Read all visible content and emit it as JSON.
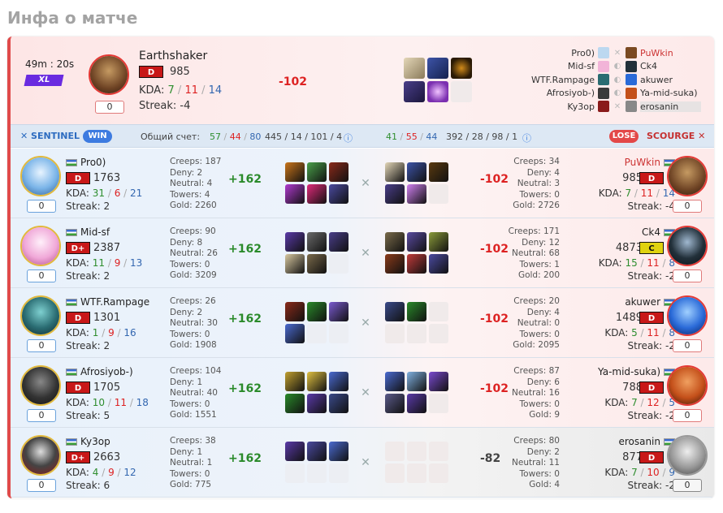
{
  "page_title": "Инфа о матче",
  "colors": {
    "radiant": "#2d6cc0",
    "dire": "#c53030",
    "win": "#3d7be0",
    "lose": "#e34848",
    "rank": "#c81818"
  },
  "featured": {
    "duration": "49m : 20s",
    "badge": "XL",
    "hero": "Earthshaker",
    "rank": "D",
    "mmr": "985",
    "kda_label": "KDA:",
    "k": "7",
    "d": "11",
    "a": "14",
    "streak": "Streak: -4",
    "score": "0",
    "diff": "-102",
    "dire_list": [
      {
        "left": "Pro0)",
        "right": "PuWkin",
        "right_style": "red"
      },
      {
        "left": "Mid-sf",
        "right": "Ck4",
        "right_style": ""
      },
      {
        "left": "WTF.Rampage",
        "right": "akuwer",
        "right_style": ""
      },
      {
        "left": "Afrosiyob-)",
        "right": "Ya-mid-suka)",
        "right_style": ""
      },
      {
        "left": "Ky3op",
        "right": "erosanin",
        "right_style": "hl"
      }
    ]
  },
  "bar": {
    "sentinel": "SENTINEL",
    "win": "WIN",
    "score_label": "Общий счет:",
    "s_k": "57",
    "s_d": "44",
    "s_a": "80",
    "s_extra": "445 / 14 / 101 / 4",
    "d_k": "41",
    "d_d": "55",
    "d_a": "44",
    "d_extra": "392 / 28 / 98 / 1",
    "lose": "LOSE",
    "scourge": "SCOURGE"
  },
  "rows": [
    {
      "name": "Pro0)",
      "rank": "D",
      "mmr": "1763",
      "k": "31",
      "d": "6",
      "a": "21",
      "streak": "Streak: 2",
      "score": "0",
      "creeps": "Creeps: 187",
      "deny": "Deny: 2",
      "neutral": "Neutral: 4",
      "towers": "Towers: 4",
      "gold": "Gold: 2260",
      "diff": "+162",
      "r_creeps": "Creeps: 34",
      "r_deny": "Deny: 4",
      "r_neutral": "Neutral: 3",
      "r_towers": "Towers: 0",
      "r_gold": "Gold: 2726",
      "r_diff": "-102",
      "r_name": "PuWkin",
      "r_rank": "D",
      "r_mmr": "985",
      "r_k": "7",
      "r_d": "11",
      "r_a": "14",
      "r_streak": "Streak: -4",
      "r_score": "0"
    },
    {
      "name": "Mid-sf",
      "rank": "D+",
      "mmr": "2387",
      "k": "11",
      "d": "9",
      "a": "13",
      "streak": "Streak: 2",
      "score": "0",
      "creeps": "Creeps: 90",
      "deny": "Deny: 8",
      "neutral": "Neutral: 26",
      "towers": "Towers: 0",
      "gold": "Gold: 3209",
      "diff": "+162",
      "r_creeps": "Creeps: 171",
      "r_deny": "Deny: 12",
      "r_neutral": "Neutral: 68",
      "r_towers": "Towers: 1",
      "r_gold": "Gold: 200",
      "r_diff": "-102",
      "r_name": "Ck4",
      "r_rank": "C",
      "r_mmr": "4873",
      "r_k": "15",
      "r_d": "11",
      "r_a": "8",
      "r_streak": "Streak: -2",
      "r_score": "0"
    },
    {
      "name": "WTF.Rampage",
      "rank": "D",
      "mmr": "1301",
      "k": "1",
      "d": "9",
      "a": "16",
      "streak": "Streak: 2",
      "score": "0",
      "creeps": "Creeps: 26",
      "deny": "Deny: 2",
      "neutral": "Neutral: 30",
      "towers": "Towers: 0",
      "gold": "Gold: 1908",
      "diff": "+162",
      "r_creeps": "Creeps: 20",
      "r_deny": "Deny: 4",
      "r_neutral": "Neutral: 0",
      "r_towers": "Towers: 0",
      "r_gold": "Gold: 2095",
      "r_diff": "-102",
      "r_name": "akuwer",
      "r_rank": "D",
      "r_mmr": "1489",
      "r_k": "5",
      "r_d": "11",
      "r_a": "8",
      "r_streak": "Streak: -2",
      "r_score": "0"
    },
    {
      "name": "Afrosiyob-)",
      "rank": "D",
      "mmr": "1705",
      "k": "10",
      "d": "11",
      "a": "18",
      "streak": "Streak: 5",
      "score": "0",
      "creeps": "Creeps: 104",
      "deny": "Deny: 1",
      "neutral": "Neutral: 40",
      "towers": "Towers: 0",
      "gold": "Gold: 1551",
      "diff": "+162",
      "r_creeps": "Creeps: 87",
      "r_deny": "Deny: 6",
      "r_neutral": "Neutral: 16",
      "r_towers": "Towers: 0",
      "r_gold": "Gold: 9",
      "r_diff": "-102",
      "r_name": "Ya-mid-suka)",
      "r_rank": "D",
      "r_mmr": "788",
      "r_k": "7",
      "r_d": "12",
      "r_a": "5",
      "r_streak": "Streak: -2",
      "r_score": "0"
    },
    {
      "name": "Ky3op",
      "rank": "D+",
      "mmr": "2663",
      "k": "4",
      "d": "9",
      "a": "12",
      "streak": "Streak: 6",
      "score": "0",
      "creeps": "Creeps: 38",
      "deny": "Deny: 1",
      "neutral": "Neutral: 1",
      "towers": "Towers: 0",
      "gold": "Gold: 775",
      "diff": "+162",
      "r_creeps": "Creeps: 80",
      "r_deny": "Deny: 2",
      "r_neutral": "Neutral: 11",
      "r_towers": "Towers: 0",
      "r_gold": "Gold: 4",
      "r_diff": "-82",
      "r_name": "erosanin",
      "r_rank": "D",
      "r_mmr": "877",
      "r_k": "7",
      "r_d": "10",
      "r_a": "9",
      "r_streak": "Streak: -2",
      "r_score": "0"
    }
  ]
}
